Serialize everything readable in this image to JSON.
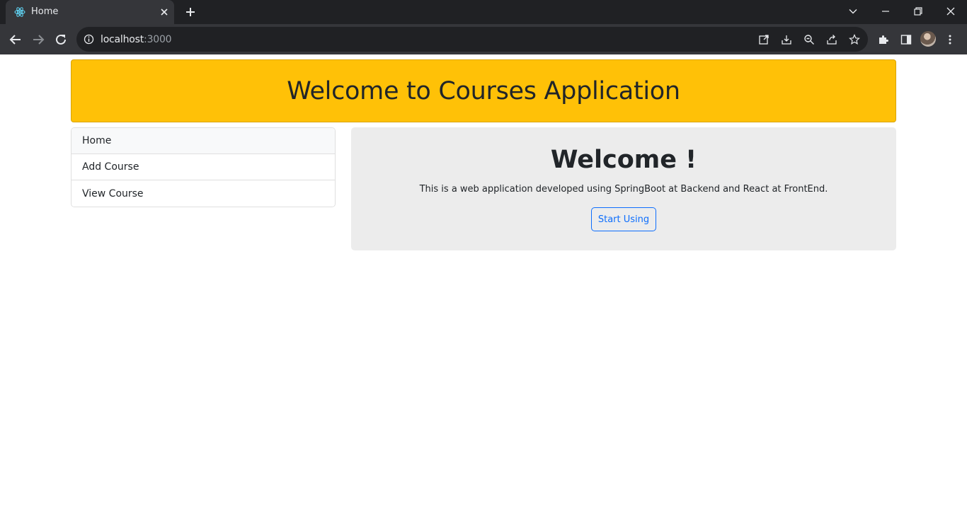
{
  "browser": {
    "tab_title": "Home",
    "url_host": "localhost",
    "url_port": ":3000",
    "icons": {
      "favicon": "react-icon",
      "close": "close-icon",
      "new_tab": "plus-icon",
      "back": "arrow-left-icon",
      "forward": "arrow-right-icon",
      "reload": "reload-icon",
      "info": "info-icon",
      "open_in_app": "external-link-icon",
      "install": "install-icon",
      "zoom": "zoom-out-icon",
      "share": "share-icon",
      "bookmark": "star-icon",
      "extensions": "puzzle-icon",
      "side_panel": "side-panel-icon",
      "menu": "kebab-menu-icon"
    }
  },
  "header": {
    "title": "Welcome to Courses Application",
    "color": "#ffc107"
  },
  "sidebar": {
    "items": [
      {
        "label": "Home"
      },
      {
        "label": "Add Course"
      },
      {
        "label": "View Course"
      }
    ]
  },
  "main": {
    "heading": "Welcome !",
    "description": "This is a web application developed using SpringBoot at Backend and React at FrontEnd.",
    "button_label": "Start Using",
    "button_color": "#0d6efd"
  }
}
